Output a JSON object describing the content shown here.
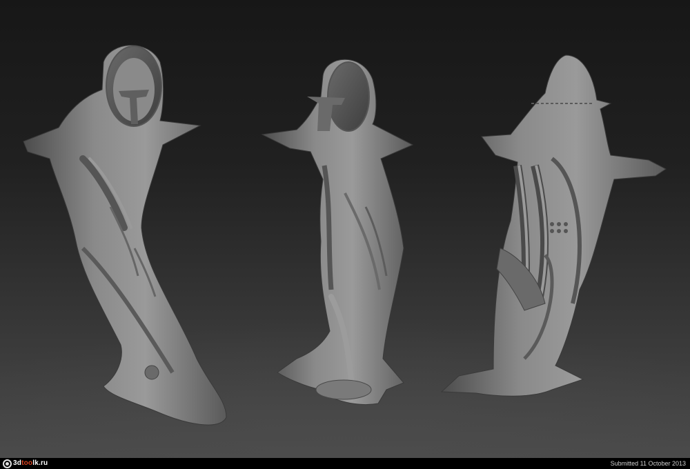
{
  "image": {
    "subject": "three-views-of-sculpted-biomechanical-shark-creature",
    "background_gradient": [
      "#171717",
      "#4a4a4a"
    ],
    "model_color": "#7a7a7a"
  },
  "footer": {
    "logo": {
      "prefix": "3d",
      "highlight": "too",
      "suffix": "lk.ru",
      "accent_color": "#d8401e"
    },
    "submitted_text": "Submitted 11 October 2013"
  }
}
